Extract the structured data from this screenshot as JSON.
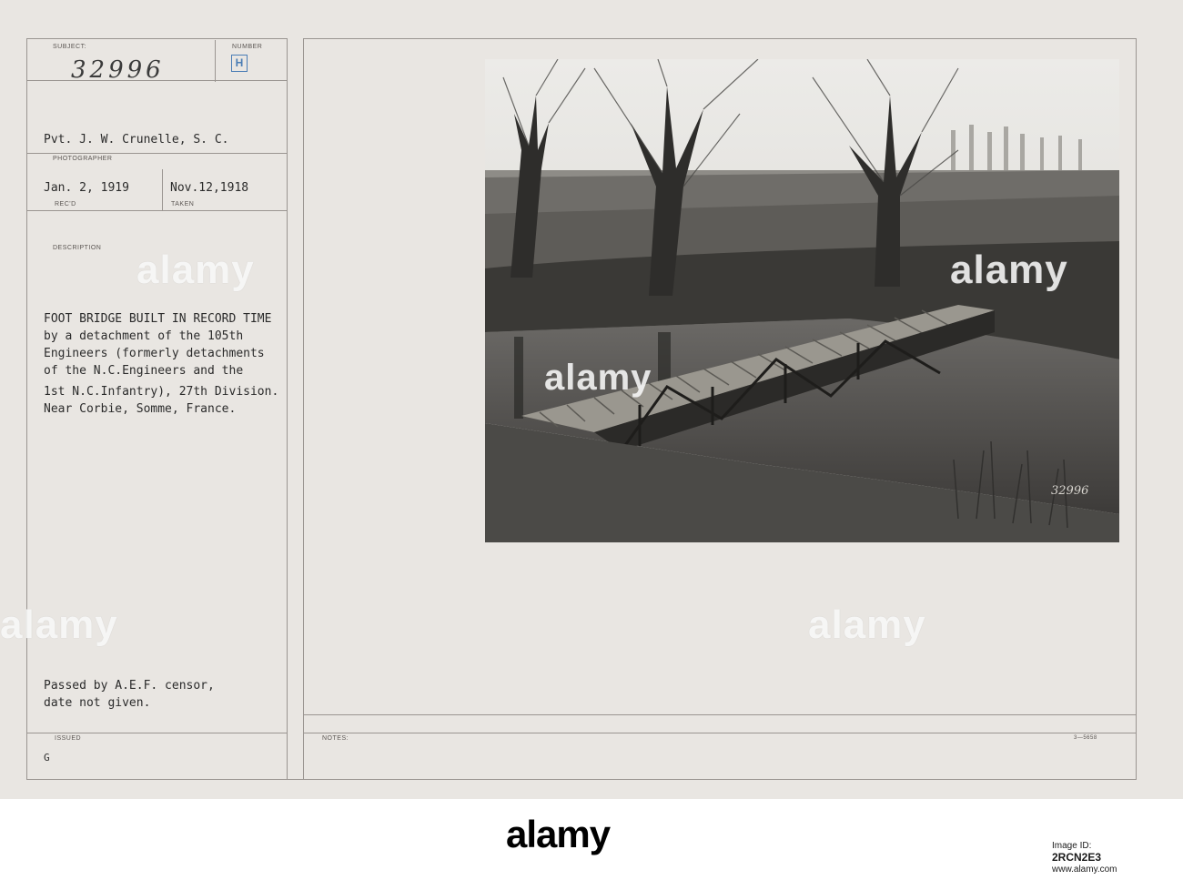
{
  "card": {
    "subject_label": "SUBJECT:",
    "number_label": "NUMBER",
    "subject_number": "32996",
    "number_stamp": "H",
    "photographer": "Pvt. J. W. Crunelle, S. C.",
    "photographer_label": "PHOTOGRAPHER",
    "received_date": "Jan. 2, 1919",
    "received_label": "REC'D",
    "taken_date": "Nov.12,1918",
    "taken_label": "TAKEN",
    "description_label": "DESCRIPTION",
    "description_lines": [
      "FOOT BRIDGE BUILT IN RECORD TIME",
      "by a detachment of the 105th",
      "Engineers (formerly detachments",
      "of the N.C.Engineers and the",
      "1st N.C.Infantry), 27th Division.",
      "Near Corbie, Somme, France."
    ],
    "censor_lines": [
      "Passed by A.E.F. censor,",
      "date not given."
    ],
    "issued_label": "ISSUED",
    "issued_value": "G",
    "notes_label": "NOTES:",
    "form_code": "3—5658",
    "photo_number": "32996"
  },
  "watermark": {
    "text": "alamy"
  },
  "footer": {
    "brand": "alamy",
    "image_id_label": "Image ID:",
    "image_id": "2RCN2E3",
    "site": "www.alamy.com"
  },
  "colors": {
    "card": "#e9e6e2",
    "rule": "#9a9591",
    "stamp": "#4a7db5"
  },
  "photo": {
    "icon": "photograph-bridge-over-stream"
  }
}
